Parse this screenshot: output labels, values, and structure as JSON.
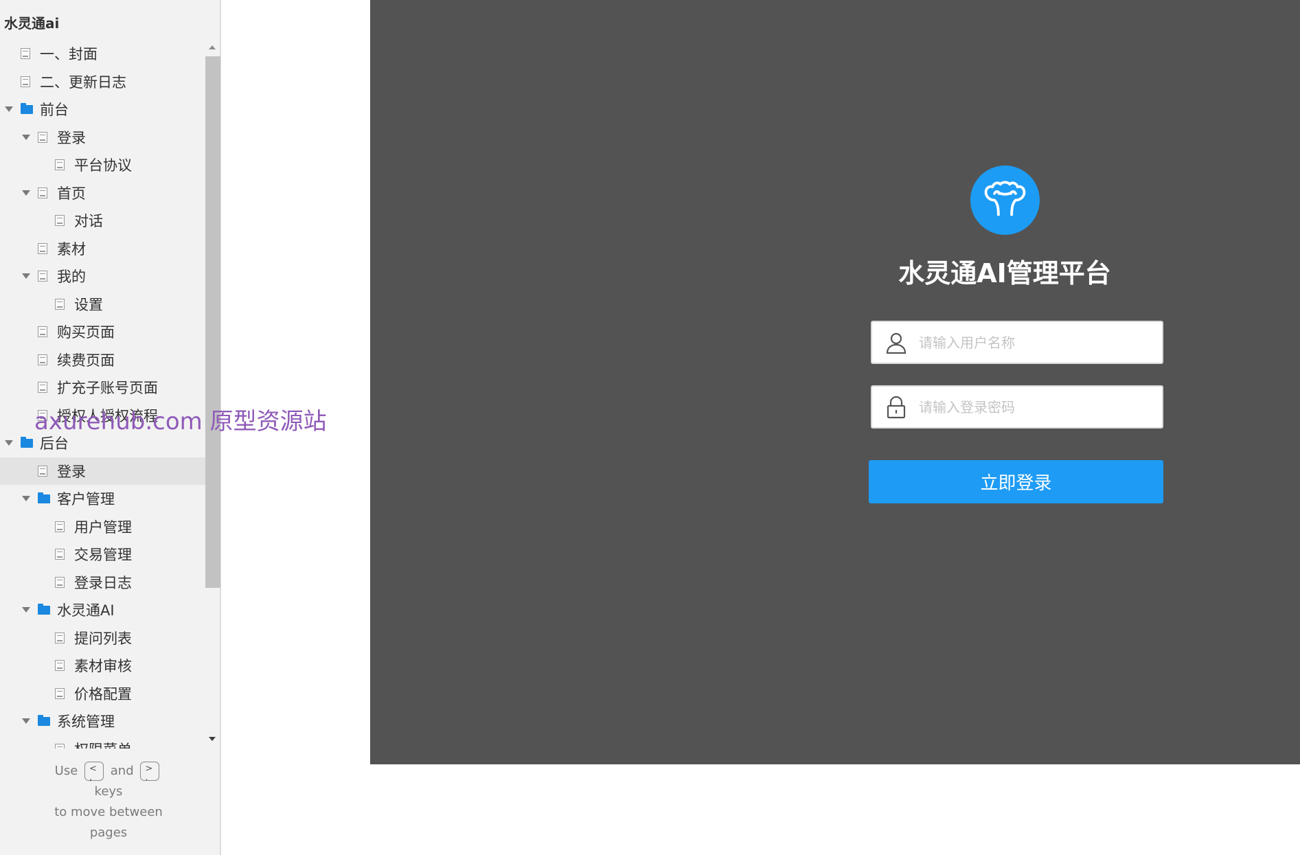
{
  "sidebar": {
    "project_title": "水灵通ai",
    "tree": [
      {
        "label": "一、封面",
        "type": "page",
        "level": 0,
        "expanded": null,
        "selected": false
      },
      {
        "label": "二、更新日志",
        "type": "page",
        "level": 0,
        "expanded": null,
        "selected": false
      },
      {
        "label": "前台",
        "type": "folder",
        "level": 0,
        "expanded": true,
        "selected": false
      },
      {
        "label": "登录",
        "type": "page",
        "level": 1,
        "expanded": true,
        "selected": false
      },
      {
        "label": "平台协议",
        "type": "page",
        "level": 2,
        "expanded": null,
        "selected": false
      },
      {
        "label": "首页",
        "type": "page",
        "level": 1,
        "expanded": true,
        "selected": false
      },
      {
        "label": "对话",
        "type": "page",
        "level": 2,
        "expanded": null,
        "selected": false
      },
      {
        "label": "素材",
        "type": "page",
        "level": 1,
        "expanded": null,
        "selected": false
      },
      {
        "label": "我的",
        "type": "page",
        "level": 1,
        "expanded": true,
        "selected": false
      },
      {
        "label": "设置",
        "type": "page",
        "level": 2,
        "expanded": null,
        "selected": false
      },
      {
        "label": "购买页面",
        "type": "page",
        "level": 1,
        "expanded": null,
        "selected": false
      },
      {
        "label": "续费页面",
        "type": "page",
        "level": 1,
        "expanded": null,
        "selected": false
      },
      {
        "label": "扩充子账号页面",
        "type": "page",
        "level": 1,
        "expanded": null,
        "selected": false
      },
      {
        "label": "授权人授权流程",
        "type": "page",
        "level": 1,
        "expanded": null,
        "selected": false
      },
      {
        "label": "后台",
        "type": "folder",
        "level": 0,
        "expanded": true,
        "selected": false
      },
      {
        "label": "登录",
        "type": "page",
        "level": 1,
        "expanded": null,
        "selected": true
      },
      {
        "label": "客户管理",
        "type": "folder",
        "level": 1,
        "expanded": true,
        "selected": false
      },
      {
        "label": "用户管理",
        "type": "page",
        "level": 2,
        "expanded": null,
        "selected": false
      },
      {
        "label": "交易管理",
        "type": "page",
        "level": 2,
        "expanded": null,
        "selected": false
      },
      {
        "label": "登录日志",
        "type": "page",
        "level": 2,
        "expanded": null,
        "selected": false
      },
      {
        "label": "水灵通AI",
        "type": "folder",
        "level": 1,
        "expanded": true,
        "selected": false
      },
      {
        "label": "提问列表",
        "type": "page",
        "level": 2,
        "expanded": null,
        "selected": false
      },
      {
        "label": "素材审核",
        "type": "page",
        "level": 2,
        "expanded": null,
        "selected": false
      },
      {
        "label": "价格配置",
        "type": "page",
        "level": 2,
        "expanded": null,
        "selected": false
      },
      {
        "label": "系统管理",
        "type": "folder",
        "level": 1,
        "expanded": true,
        "selected": false
      },
      {
        "label": "权限菜单",
        "type": "page",
        "level": 2,
        "expanded": null,
        "selected": false
      }
    ],
    "nav_hint": {
      "use": "Use",
      "prev_key": "<\n,",
      "and": "and",
      "next_key": ">\n.",
      "keys": "keys",
      "line2": "to move between",
      "line3": "pages"
    }
  },
  "watermark": "axurehub.com 原型资源站",
  "login": {
    "title": "水灵通AI管理平台",
    "username_placeholder": "请输入用户名称",
    "username_value": "",
    "password_placeholder": "请输入登录密码",
    "password_value": "",
    "submit_label": "立即登录"
  },
  "colors": {
    "accent": "#1e9bf5",
    "canvas_bg": "#535353",
    "sidebar_bg": "#f2f2f2",
    "folder_icon": "#1a88e0",
    "watermark": "#8f5ab8"
  },
  "icons": {
    "logo": "muscle-arms-icon",
    "username": "user-icon",
    "password": "lock-icon",
    "page": "page-icon",
    "folder": "folder-icon"
  }
}
